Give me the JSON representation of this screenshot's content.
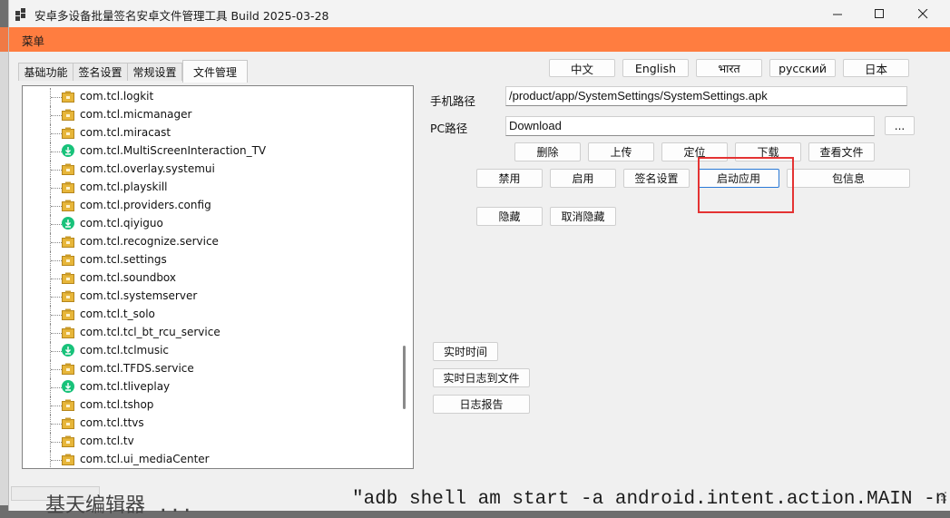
{
  "window": {
    "title": "安卓多设备批量签名安卓文件管理工具 Build 2025-03-28"
  },
  "menu": {
    "label": "菜单"
  },
  "tabs": [
    "基础功能",
    "签名设置",
    "常规设置",
    "文件管理"
  ],
  "languages": [
    "中文",
    "English",
    "भारत",
    "русский",
    "日本"
  ],
  "tree": {
    "items": [
      {
        "label": "com.tcl.logkit",
        "icon": "package-icon"
      },
      {
        "label": "com.tcl.micmanager",
        "icon": "package-icon"
      },
      {
        "label": "com.tcl.miracast",
        "icon": "package-icon"
      },
      {
        "label": "com.tcl.MultiScreenInteraction_TV",
        "icon": "apk-icon"
      },
      {
        "label": "com.tcl.overlay.systemui",
        "icon": "package-icon"
      },
      {
        "label": "com.tcl.playskill",
        "icon": "package-icon"
      },
      {
        "label": "com.tcl.providers.config",
        "icon": "package-icon"
      },
      {
        "label": "com.tcl.qiyiguo",
        "icon": "apk-icon"
      },
      {
        "label": "com.tcl.recognize.service",
        "icon": "package-icon"
      },
      {
        "label": "com.tcl.settings",
        "icon": "package-icon"
      },
      {
        "label": "com.tcl.soundbox",
        "icon": "package-icon"
      },
      {
        "label": "com.tcl.systemserver",
        "icon": "package-icon"
      },
      {
        "label": "com.tcl.t_solo",
        "icon": "package-icon"
      },
      {
        "label": "com.tcl.tcl_bt_rcu_service",
        "icon": "package-icon"
      },
      {
        "label": "com.tcl.tclmusic",
        "icon": "apk-icon"
      },
      {
        "label": "com.tcl.TFDS.service",
        "icon": "package-icon"
      },
      {
        "label": "com.tcl.tliveplay",
        "icon": "apk-icon"
      },
      {
        "label": "com.tcl.tshop",
        "icon": "package-icon"
      },
      {
        "label": "com.tcl.ttvs",
        "icon": "package-icon"
      },
      {
        "label": "com.tcl.tv",
        "icon": "package-icon"
      },
      {
        "label": "com.tcl.ui_mediaCenter",
        "icon": "package-icon"
      }
    ]
  },
  "fields": {
    "phone_path_label": "手机路径",
    "phone_path_value": "/product/app/SystemSettings/SystemSettings.apk",
    "pc_path_label": "PC路径",
    "pc_path_value": "Download",
    "browse_label": "..."
  },
  "actions": {
    "delete": "删除",
    "upload": "上传",
    "locate": "定位",
    "download": "下载",
    "view_file": "查看文件",
    "disable": "禁用",
    "enable": "启用",
    "sign_settings": "签名设置",
    "launch_app": "启动应用",
    "package_info": "包信息",
    "hide": "隐藏",
    "unhide": "取消隐藏",
    "realtime": "实时时间",
    "realtime_log_to_file": "实时日志到文件",
    "log_report": "日志报告"
  },
  "background": {
    "left_text": "基天编辑器 ...",
    "right_text": "\"adb shell am start -a android.intent.action.MAIN -n"
  },
  "colors": {
    "menubar": "#ff7d40",
    "highlight": "#e43333",
    "apk_icon": "#18c27a",
    "package_icon": "#e7b63a"
  }
}
